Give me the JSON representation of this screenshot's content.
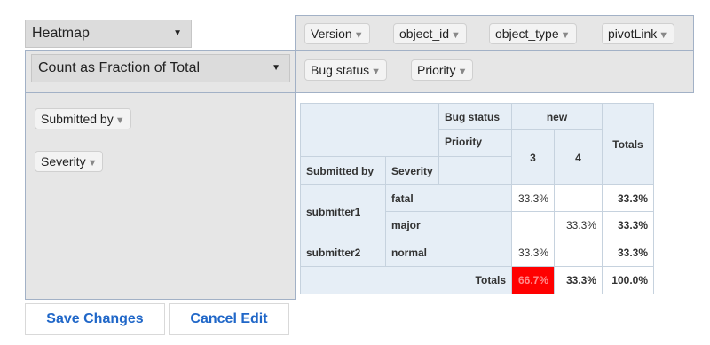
{
  "renderer": {
    "selected": "Heatmap"
  },
  "aggregator": {
    "selected": "Count as Fraction of Total"
  },
  "unused_attributes": [
    "Version",
    "object_id",
    "object_type",
    "pivotLink"
  ],
  "col_attributes": [
    "Bug status",
    "Priority"
  ],
  "row_attributes": [
    "Submitted by",
    "Severity"
  ],
  "pivot": {
    "col_attr_labels": [
      "Bug status",
      "Priority"
    ],
    "row_attr_labels": [
      "Submitted by",
      "Severity"
    ],
    "col_group": "new",
    "col_keys": [
      "3",
      "4"
    ],
    "totals_label": "Totals",
    "groups": [
      {
        "label": "submitter1",
        "rows": [
          {
            "label": "fatal",
            "cells": [
              "33.3%",
              ""
            ],
            "total": "33.3%"
          },
          {
            "label": "major",
            "cells": [
              "",
              "33.3%"
            ],
            "total": "33.3%"
          }
        ]
      },
      {
        "label": "submitter2",
        "rows": [
          {
            "label": "normal",
            "cells": [
              "33.3%",
              ""
            ],
            "total": "33.3%"
          }
        ]
      }
    ],
    "col_totals": [
      "66.7%",
      "33.3%"
    ],
    "grand_total": "100.0%",
    "heat_color": "#ff0000"
  },
  "buttons": {
    "save": "Save Changes",
    "cancel": "Cancel Edit"
  }
}
